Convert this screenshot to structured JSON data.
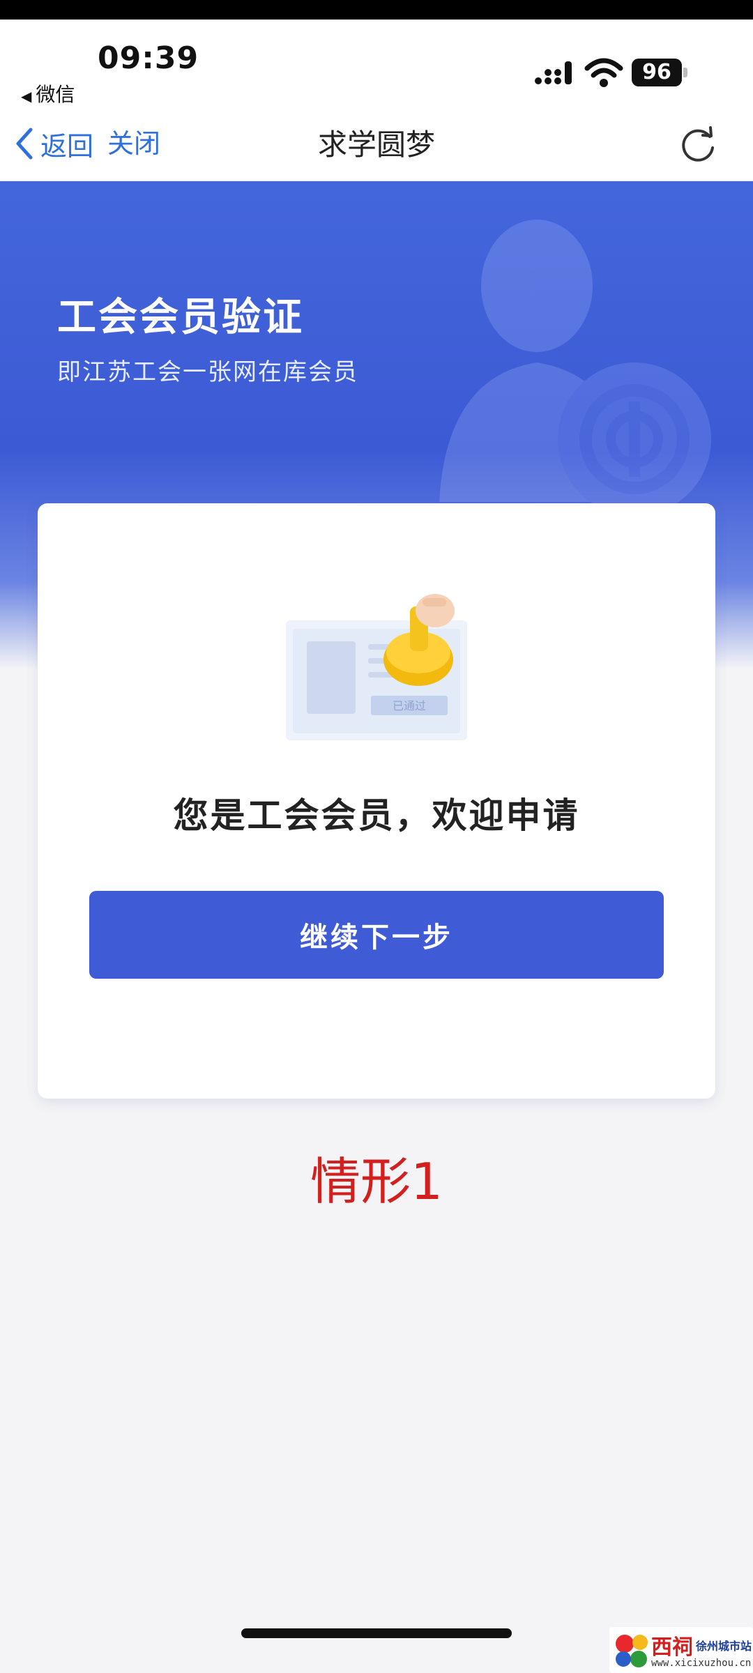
{
  "status_bar": {
    "time": "09:39",
    "back_app": "微信",
    "battery": "96"
  },
  "nav": {
    "back_label": "返回",
    "close_label": "关闭",
    "title": "求学圆梦"
  },
  "hero": {
    "title": "工会会员验证",
    "subtitle": "即江苏工会一张网在库会员"
  },
  "card": {
    "illustration_badge": "已通过",
    "message": "您是工会会员，欢迎申请",
    "next_button": "继续下一步"
  },
  "annotation": {
    "scenario_label": "情形1"
  },
  "watermark": {
    "brand": "西祠",
    "city": "徐州城市站",
    "url": "www.xicixuzhou.cn"
  },
  "colors": {
    "brand_blue": "#3f5bd6",
    "nav_link": "#2f6fde",
    "annotation_red": "#d2201e"
  }
}
